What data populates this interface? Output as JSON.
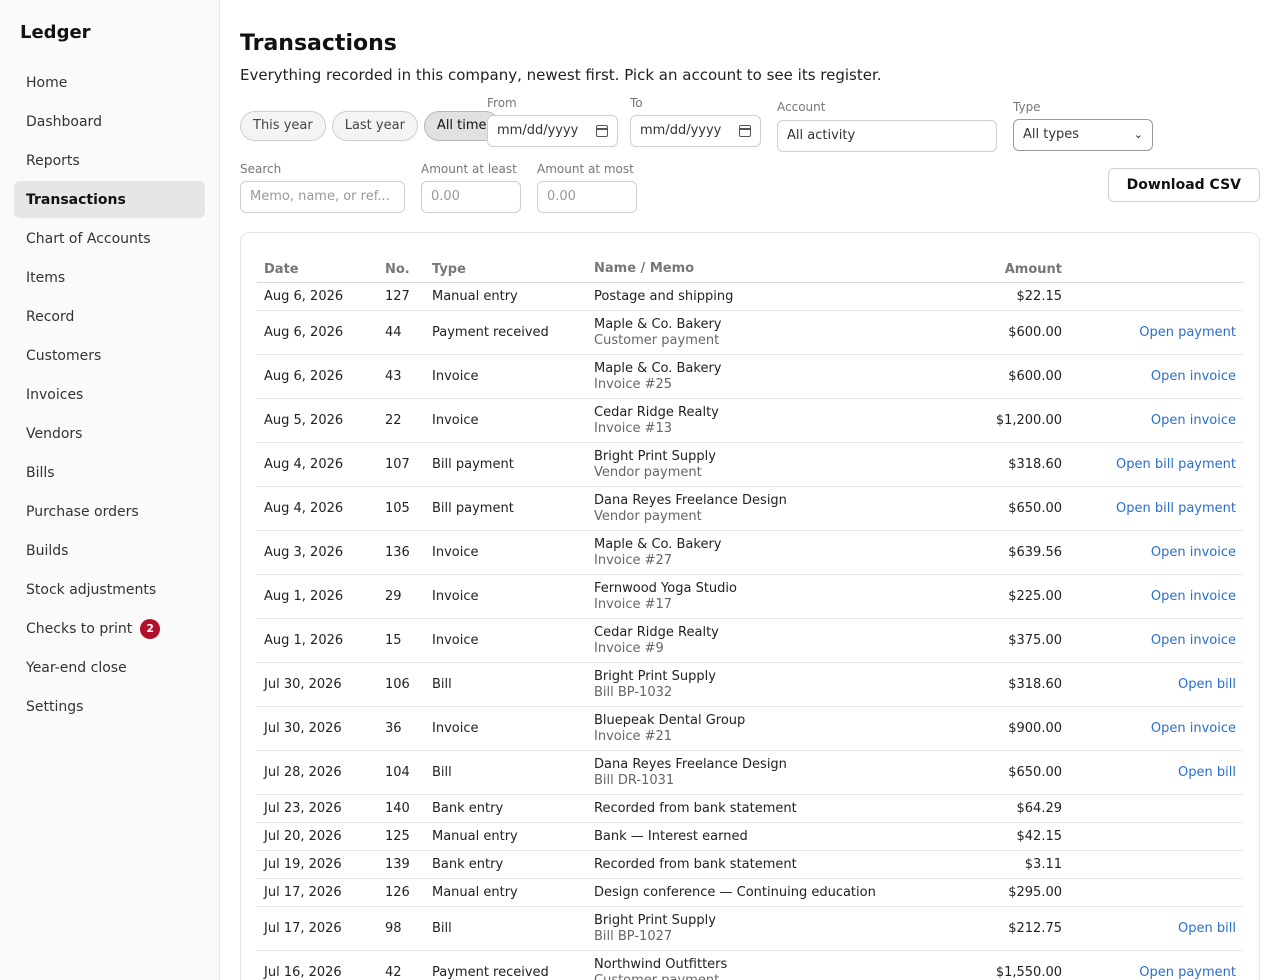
{
  "app": {
    "brand": "Ledger"
  },
  "sidebar": {
    "items": [
      {
        "label": "Home"
      },
      {
        "label": "Dashboard"
      },
      {
        "label": "Reports"
      },
      {
        "label": "Transactions",
        "active": true
      },
      {
        "label": "Chart of Accounts"
      },
      {
        "label": "Items"
      },
      {
        "label": "Record"
      },
      {
        "label": "Customers"
      },
      {
        "label": "Invoices"
      },
      {
        "label": "Vendors"
      },
      {
        "label": "Bills"
      },
      {
        "label": "Purchase orders"
      },
      {
        "label": "Builds"
      },
      {
        "label": "Stock adjustments"
      },
      {
        "label": "Checks to print",
        "badge": "2"
      },
      {
        "label": "Year-end close"
      },
      {
        "label": "Settings"
      }
    ]
  },
  "header": {
    "title": "Transactions",
    "subtitle": "Everything recorded in this company, newest first. Pick an account to see its register."
  },
  "filters": {
    "ranges": [
      {
        "label": "This year"
      },
      {
        "label": "Last year"
      },
      {
        "label": "All time",
        "active": true
      }
    ],
    "from_label": "From",
    "from_placeholder": "mm/dd/yyyy",
    "to_label": "To",
    "to_placeholder": "mm/dd/yyyy",
    "account_label": "Account",
    "account_value": "All activity",
    "type_label": "Type",
    "type_value": "All types",
    "search_label": "Search",
    "search_placeholder": "Memo, name, or ref...",
    "amount_min_label": "Amount at least",
    "amount_min_placeholder": "0.00",
    "amount_max_label": "Amount at most",
    "amount_max_placeholder": "0.00",
    "download_label": "Download CSV"
  },
  "table": {
    "headers": {
      "date": "Date",
      "no": "No.",
      "type": "Type",
      "name": "Name / Memo",
      "amount": "Amount"
    },
    "rows": [
      {
        "date": "Aug 6, 2026",
        "no": "127",
        "type": "Manual entry",
        "name": "Postage and shipping",
        "sub": "",
        "amount": "$22.15",
        "action": ""
      },
      {
        "date": "Aug 6, 2026",
        "no": "44",
        "type": "Payment received",
        "name": "Maple & Co. Bakery",
        "sub": "Customer payment",
        "amount": "$600.00",
        "action": "Open payment"
      },
      {
        "date": "Aug 6, 2026",
        "no": "43",
        "type": "Invoice",
        "name": "Maple & Co. Bakery",
        "sub": "Invoice #25",
        "amount": "$600.00",
        "action": "Open invoice"
      },
      {
        "date": "Aug 5, 2026",
        "no": "22",
        "type": "Invoice",
        "name": "Cedar Ridge Realty",
        "sub": "Invoice #13",
        "amount": "$1,200.00",
        "action": "Open invoice"
      },
      {
        "date": "Aug 4, 2026",
        "no": "107",
        "type": "Bill payment",
        "name": "Bright Print Supply",
        "sub": "Vendor payment",
        "amount": "$318.60",
        "action": "Open bill payment"
      },
      {
        "date": "Aug 4, 2026",
        "no": "105",
        "type": "Bill payment",
        "name": "Dana Reyes Freelance Design",
        "sub": "Vendor payment",
        "amount": "$650.00",
        "action": "Open bill payment"
      },
      {
        "date": "Aug 3, 2026",
        "no": "136",
        "type": "Invoice",
        "name": "Maple & Co. Bakery",
        "sub": "Invoice #27",
        "amount": "$639.56",
        "action": "Open invoice"
      },
      {
        "date": "Aug 1, 2026",
        "no": "29",
        "type": "Invoice",
        "name": "Fernwood Yoga Studio",
        "sub": "Invoice #17",
        "amount": "$225.00",
        "action": "Open invoice"
      },
      {
        "date": "Aug 1, 2026",
        "no": "15",
        "type": "Invoice",
        "name": "Cedar Ridge Realty",
        "sub": "Invoice #9",
        "amount": "$375.00",
        "action": "Open invoice"
      },
      {
        "date": "Jul 30, 2026",
        "no": "106",
        "type": "Bill",
        "name": "Bright Print Supply",
        "sub": "Bill BP-1032",
        "amount": "$318.60",
        "action": "Open bill"
      },
      {
        "date": "Jul 30, 2026",
        "no": "36",
        "type": "Invoice",
        "name": "Bluepeak Dental Group",
        "sub": "Invoice #21",
        "amount": "$900.00",
        "action": "Open invoice"
      },
      {
        "date": "Jul 28, 2026",
        "no": "104",
        "type": "Bill",
        "name": "Dana Reyes Freelance Design",
        "sub": "Bill DR-1031",
        "amount": "$650.00",
        "action": "Open bill"
      },
      {
        "date": "Jul 23, 2026",
        "no": "140",
        "type": "Bank entry",
        "name": "Recorded from bank statement",
        "sub": "",
        "amount": "$64.29",
        "action": ""
      },
      {
        "date": "Jul 20, 2026",
        "no": "125",
        "type": "Manual entry",
        "name": "Bank — Interest earned",
        "sub": "",
        "amount": "$42.15",
        "action": ""
      },
      {
        "date": "Jul 19, 2026",
        "no": "139",
        "type": "Bank entry",
        "name": "Recorded from bank statement",
        "sub": "",
        "amount": "$3.11",
        "action": ""
      },
      {
        "date": "Jul 17, 2026",
        "no": "126",
        "type": "Manual entry",
        "name": "Design conference — Continuing education",
        "sub": "",
        "amount": "$295.00",
        "action": ""
      },
      {
        "date": "Jul 17, 2026",
        "no": "98",
        "type": "Bill",
        "name": "Bright Print Supply",
        "sub": "Bill BP-1027",
        "amount": "$212.75",
        "action": "Open bill"
      },
      {
        "date": "Jul 16, 2026",
        "no": "42",
        "type": "Payment received",
        "name": "Northwind Outfitters",
        "sub": "Customer payment",
        "amount": "$1,550.00",
        "action": "Open payment"
      }
    ]
  }
}
